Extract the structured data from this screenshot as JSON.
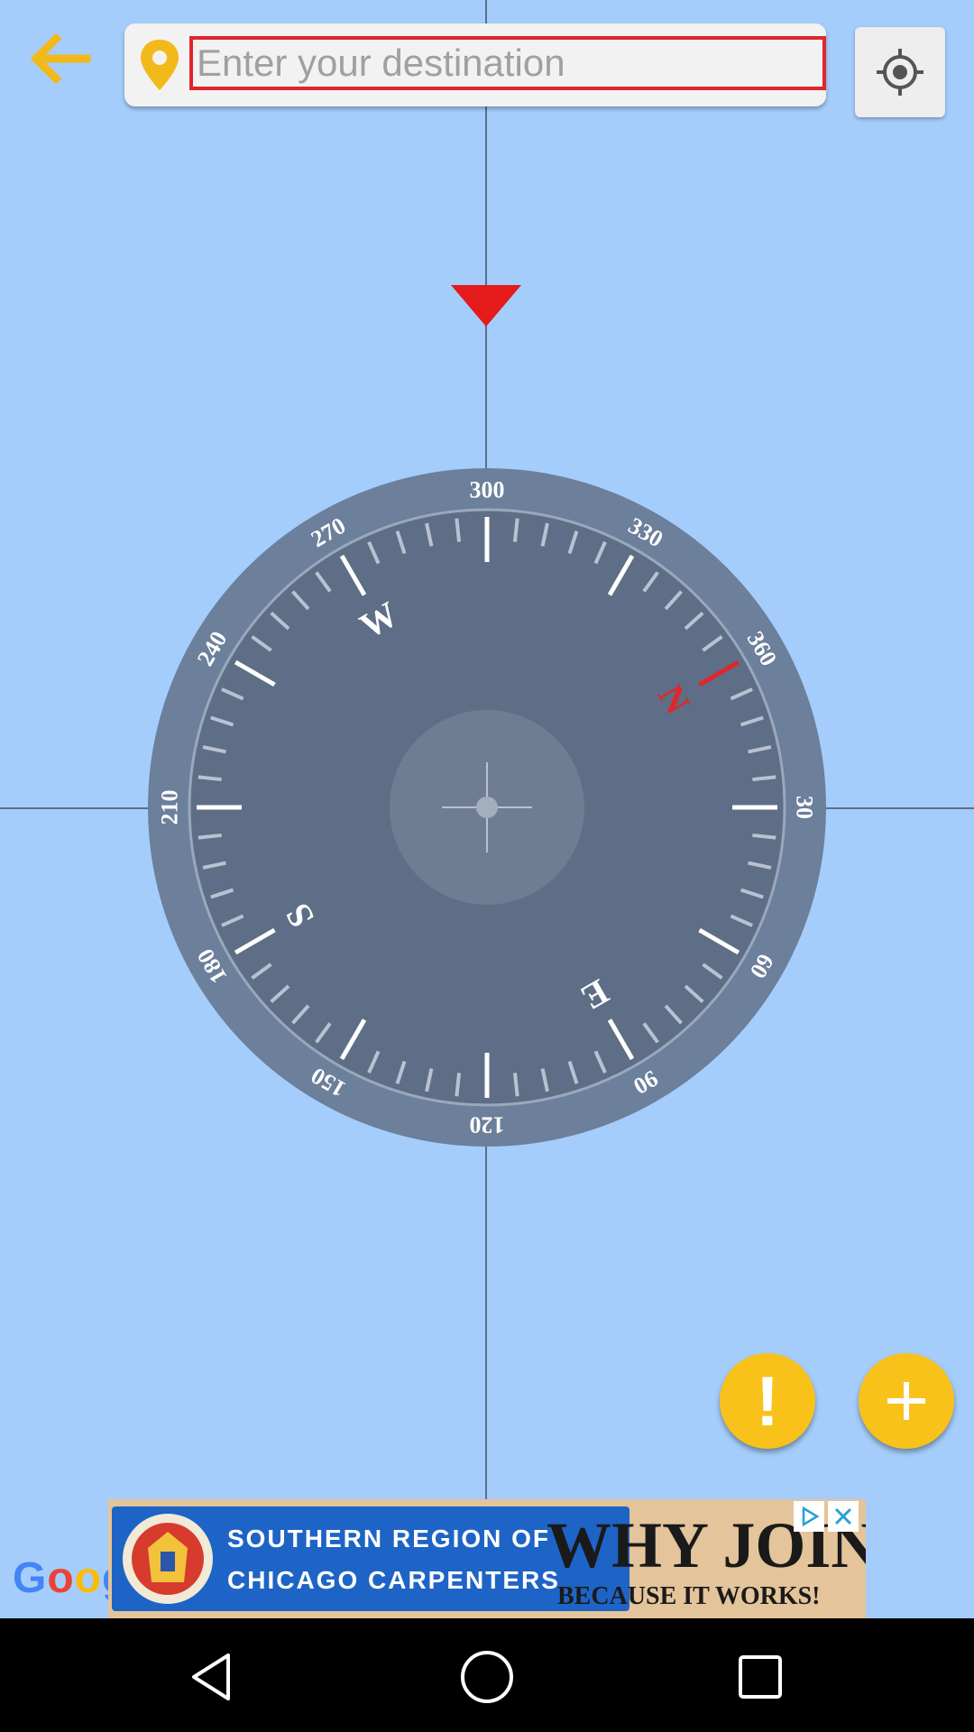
{
  "search": {
    "placeholder": "Enter your destination",
    "value": ""
  },
  "compass": {
    "rotation_deg": 60,
    "degree_labels": [
      "30",
      "60",
      "90",
      "120",
      "150",
      "180",
      "210",
      "240",
      "270",
      "300",
      "330",
      "360"
    ],
    "cardinals": {
      "N": "N",
      "E": "E",
      "S": "S",
      "W": "W"
    },
    "colors": {
      "face": "#5d6e86",
      "ring": "#6c7f9b",
      "north": "#e0262b",
      "ticks": "#ffffff"
    }
  },
  "fabs": {
    "alert_label": "!"
  },
  "map": {
    "attribution": [
      "G",
      "o",
      "o",
      "g"
    ]
  },
  "ad": {
    "line1": "SOUTHERN REGION OF",
    "line2": "CHICAGO CARPENTERS",
    "headline": "WHY JOIN?",
    "subline": "BECAUSE IT WORKS!"
  },
  "icons": [
    "back-arrow-icon",
    "location-pin-icon",
    "my-location-icon",
    "direction-pointer-icon",
    "alert-icon",
    "plus-icon",
    "ad-info-icon",
    "ad-close-icon",
    "nav-back-icon",
    "nav-home-icon",
    "nav-recent-icon"
  ],
  "colors": {
    "map": "#a5cdfb",
    "accent": "#f8c21b",
    "highlight": "#e0262b"
  }
}
